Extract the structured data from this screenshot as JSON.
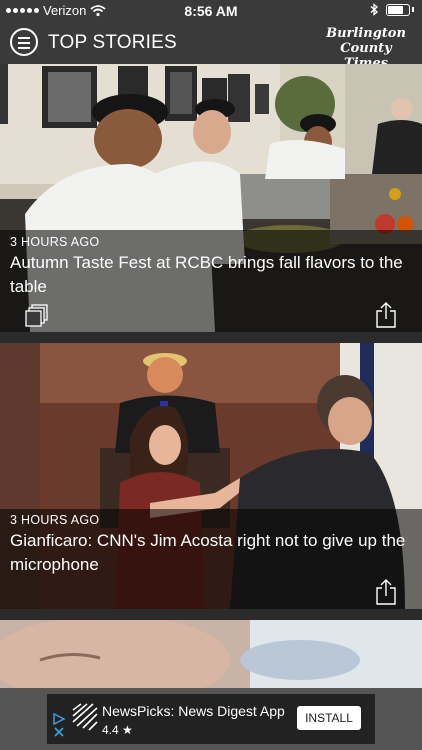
{
  "status_bar": {
    "carrier": "Verizon",
    "time": "8:56 AM"
  },
  "header": {
    "title": "TOP STORIES",
    "logo_line1": "Burlington",
    "logo_line2": "County Times"
  },
  "stories": [
    {
      "time_ago": "3 HOURS AGO",
      "headline": "Autumn Taste Fest at RCBC brings fall flavors to the table"
    },
    {
      "time_ago": "3 HOURS AGO",
      "headline": "Gianficaro: CNN's Jim Acosta right not to give up the microphone"
    }
  ],
  "ad": {
    "title": "NewsPicks: News Digest App",
    "rating": "4.4 ★",
    "button": "INSTALL"
  },
  "colors": {
    "header_bg": "#3a3a3a",
    "overlay": "rgba(0,0,0,0.55)"
  }
}
